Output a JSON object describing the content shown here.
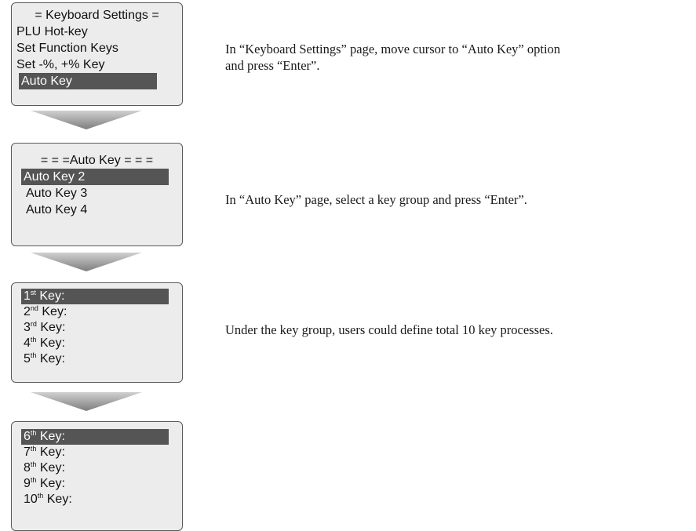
{
  "screen1": {
    "lines": [
      "= Keyboard Settings =",
      "PLU Hot-key",
      "Set Function Keys",
      "Set -%, +% Key",
      "Auto Key"
    ]
  },
  "screen2": {
    "title": "= = =Auto Key = = =",
    "lines": [
      "Auto Key 2",
      "Auto Key 3",
      "Auto Key 4"
    ]
  },
  "screen3": {
    "keys": [
      {
        "num": "1",
        "sup": "st",
        "label": " Key:"
      },
      {
        "num": "2",
        "sup": "nd",
        "label": " Key:"
      },
      {
        "num": "3",
        "sup": "rd",
        "label": " Key:"
      },
      {
        "num": "4",
        "sup": "th",
        "label": " Key:"
      },
      {
        "num": "5",
        "sup": "th",
        "label": " Key:"
      }
    ]
  },
  "screen4": {
    "keys": [
      {
        "num": "6",
        "sup": "th",
        "label": " Key:"
      },
      {
        "num": "7",
        "sup": "th",
        "label": " Key:"
      },
      {
        "num": "8",
        "sup": "th",
        "label": " Key:"
      },
      {
        "num": "9",
        "sup": "th",
        "label": " Key:"
      },
      {
        "num": "10",
        "sup": "th",
        "label": " Key:"
      }
    ]
  },
  "descriptions": {
    "step1_line1": "In “Keyboard Settings” page, move cursor to “Auto  Key” option",
    "step1_line2": "and press “Enter”.",
    "step2": "In “Auto Key” page, select a key group and press “Enter”.",
    "step3": "Under the key group, users could define total 10 key processes."
  },
  "colors": {
    "screen_bg": "#ececec",
    "highlight_bg": "#555555",
    "arrow": "#8a8a8a"
  }
}
